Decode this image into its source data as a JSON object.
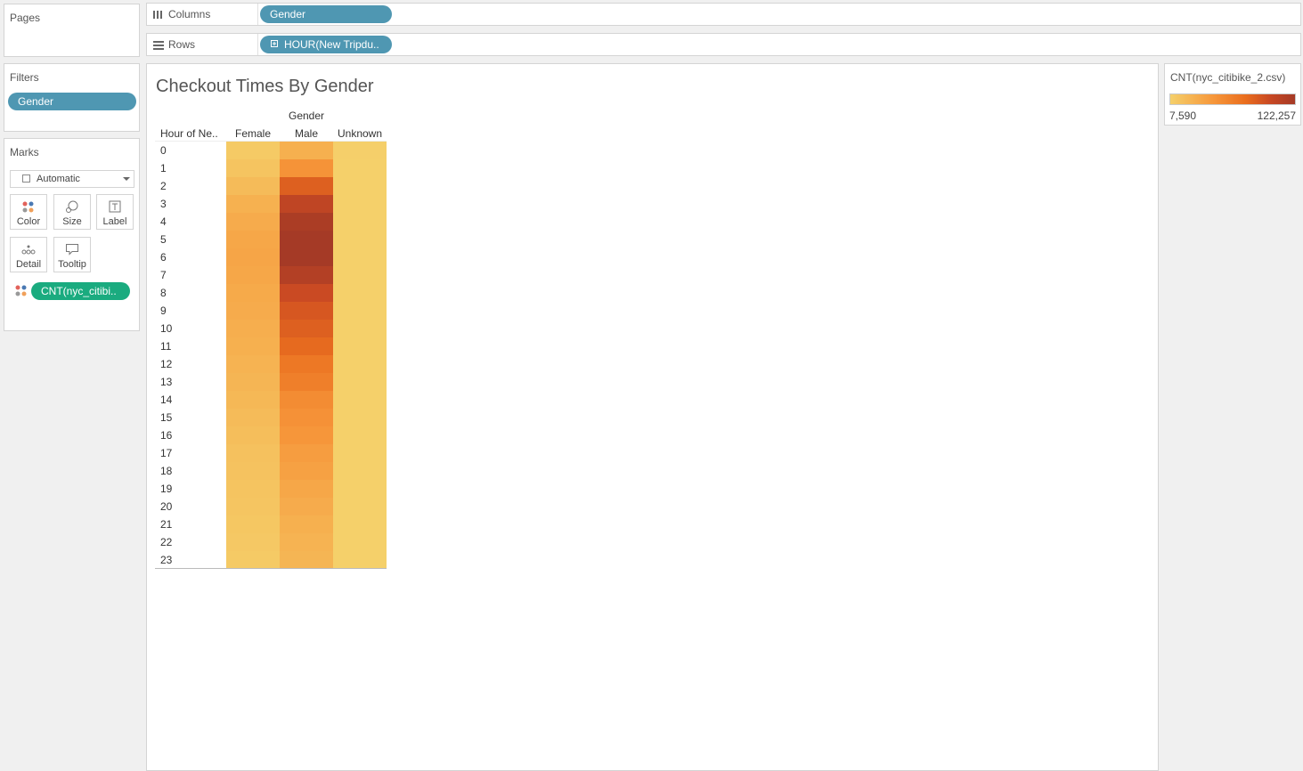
{
  "pages": {
    "title": "Pages"
  },
  "shelves": {
    "columns": {
      "label": "Columns",
      "pill": "Gender"
    },
    "rows": {
      "label": "Rows",
      "pill": "HOUR(New Tripdu.."
    }
  },
  "filters": {
    "title": "Filters",
    "pill": "Gender"
  },
  "marks": {
    "title": "Marks",
    "type_value": "Automatic",
    "buttons": {
      "color": "Color",
      "size": "Size",
      "label": "Label",
      "detail": "Detail",
      "tooltip": "Tooltip"
    },
    "color_pill": "CNT(nyc_citibi.."
  },
  "legend": {
    "title": "CNT(nyc_citibike_2.csv)",
    "min_label": "7,590",
    "max_label": "122,257",
    "min_color": "#f5cf6a",
    "max_color": "#a53a26"
  },
  "chart_data": {
    "type": "heatmap",
    "title": "Checkout Times By Gender",
    "column_header": "Gender",
    "row_header": "Hour of Ne..",
    "columns": [
      "Female",
      "Male",
      "Unknown"
    ],
    "rows": [
      "0",
      "1",
      "2",
      "3",
      "4",
      "5",
      "6",
      "7",
      "8",
      "9",
      "10",
      "11",
      "12",
      "13",
      "14",
      "15",
      "16",
      "17",
      "18",
      "19",
      "20",
      "21",
      "22",
      "23"
    ],
    "color_range": [
      7590,
      122257
    ],
    "values": [
      [
        12000,
        30000,
        8000
      ],
      [
        16000,
        50000,
        7700
      ],
      [
        22000,
        85000,
        7600
      ],
      [
        29000,
        105000,
        7600
      ],
      [
        33000,
        118000,
        7600
      ],
      [
        36000,
        122000,
        7600
      ],
      [
        37000,
        122000,
        7600
      ],
      [
        36000,
        113000,
        7600
      ],
      [
        34000,
        98000,
        7600
      ],
      [
        33000,
        90000,
        7600
      ],
      [
        31000,
        85000,
        7600
      ],
      [
        30000,
        79000,
        7600
      ],
      [
        28000,
        69000,
        7600
      ],
      [
        26000,
        64000,
        7600
      ],
      [
        24000,
        55000,
        7600
      ],
      [
        22000,
        51000,
        7600
      ],
      [
        20000,
        48000,
        7600
      ],
      [
        18000,
        43000,
        7600
      ],
      [
        17000,
        40000,
        7600
      ],
      [
        16000,
        36000,
        7600
      ],
      [
        15000,
        33000,
        7600
      ],
      [
        14000,
        30000,
        7600
      ],
      [
        13000,
        28000,
        7600
      ],
      [
        12000,
        26000,
        7600
      ]
    ]
  }
}
